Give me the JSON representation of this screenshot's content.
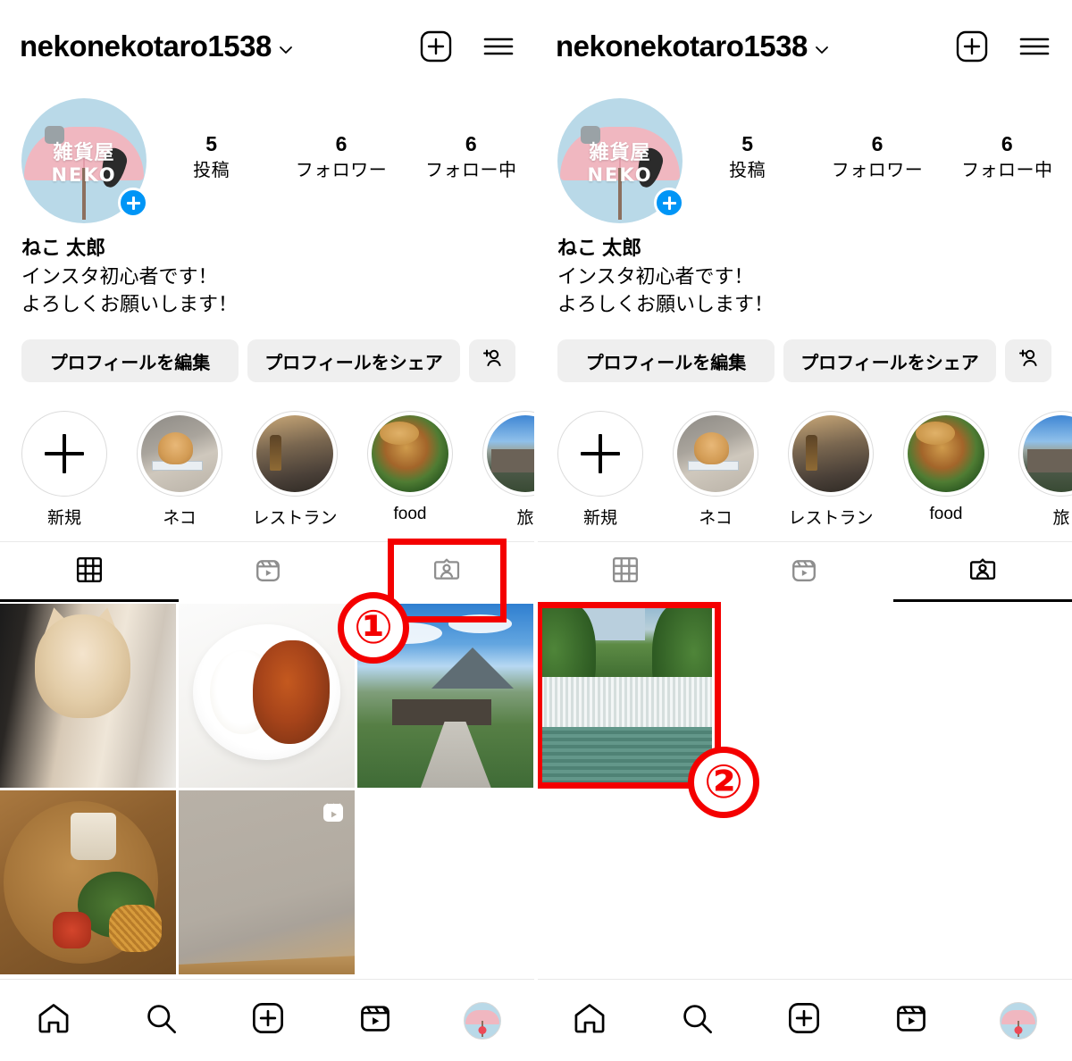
{
  "header": {
    "username": "nekonekotaro1538",
    "chevron_icon": "chevron-down-icon",
    "create_icon": "plus-square-icon",
    "menu_icon": "hamburger-menu-icon"
  },
  "profile": {
    "avatar_alt": "雑貨屋 NEKO",
    "avatar_text_jp": "雑貨屋",
    "avatar_text_en": "NEKO",
    "add_story_icon": "plus-icon",
    "display_name": "ねこ 太郎",
    "bio_lines": [
      "インスタ初心者です！",
      "よろしくお願いします！"
    ],
    "stats": [
      {
        "num": "5",
        "label": "投稿"
      },
      {
        "num": "6",
        "label": "フォロワー"
      },
      {
        "num": "6",
        "label": "フォロー中"
      }
    ]
  },
  "actions": {
    "edit_profile": "プロフィールを編集",
    "share_profile": "プロフィールをシェア",
    "add_person_icon": "add-person-icon"
  },
  "highlights": [
    {
      "label": "新規",
      "type": "new",
      "icon": "plus-icon"
    },
    {
      "label": "ネコ",
      "type": "cat"
    },
    {
      "label": "レストラン",
      "type": "restaurant"
    },
    {
      "label": "food",
      "type": "food"
    },
    {
      "label": "旅",
      "type": "travel"
    }
  ],
  "tabs": [
    {
      "name": "grid",
      "icon": "grid-icon"
    },
    {
      "name": "reels",
      "icon": "reels-icon"
    },
    {
      "name": "tagged",
      "icon": "tagged-person-icon"
    }
  ],
  "left_panel": {
    "active_tab": "grid",
    "posts": [
      {
        "art": "p-cat",
        "alt": "cat"
      },
      {
        "art": "p-curry",
        "alt": "curry rice"
      },
      {
        "art": "p-mount",
        "alt": "mountain landscape"
      },
      {
        "art": "p-plate",
        "alt": "food platter"
      },
      {
        "art": "p-reel",
        "alt": "reel video",
        "badge": "reels-icon"
      }
    ]
  },
  "right_panel": {
    "active_tab": "tagged",
    "posts": [
      {
        "art": "p-fall",
        "alt": "waterfall"
      }
    ]
  },
  "bottom_nav": [
    {
      "name": "home",
      "icon": "home-icon"
    },
    {
      "name": "search",
      "icon": "search-icon"
    },
    {
      "name": "create",
      "icon": "plus-square-icon"
    },
    {
      "name": "reels",
      "icon": "reels-icon"
    },
    {
      "name": "profile",
      "icon": "profile-avatar",
      "badge_dot": true
    }
  ],
  "annotations": [
    {
      "id": "1",
      "label": "①",
      "target": "tagged-tab-left"
    },
    {
      "id": "2",
      "label": "②",
      "target": "tagged-post-right"
    }
  ],
  "colors": {
    "accent_blue": "#0095f6",
    "annotation_red": "#f40000",
    "button_bg": "#efefef",
    "badge_red": "#ed4956"
  }
}
